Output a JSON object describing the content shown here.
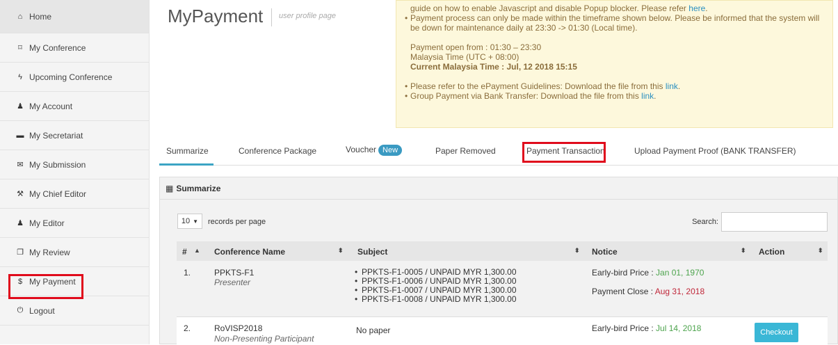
{
  "sidebar": {
    "items": [
      {
        "label": "Home",
        "icon": "home-icon",
        "glyph": "⌂"
      },
      {
        "label": "My Conference",
        "icon": "bookmark-icon",
        "glyph": "⌑"
      },
      {
        "label": "Upcoming Conference",
        "icon": "bolt-icon",
        "glyph": "ϟ"
      },
      {
        "label": "My Account",
        "icon": "user-icon",
        "glyph": "♟"
      },
      {
        "label": "My Secretariat",
        "icon": "briefcase-icon",
        "glyph": "▬"
      },
      {
        "label": "My Submission",
        "icon": "envelope-icon",
        "glyph": "✉"
      },
      {
        "label": "My Chief Editor",
        "icon": "gavel-icon",
        "glyph": "⚒"
      },
      {
        "label": "My Editor",
        "icon": "users-icon",
        "glyph": "♟"
      },
      {
        "label": "My Review",
        "icon": "files-icon",
        "glyph": "❐"
      },
      {
        "label": "My Payment",
        "icon": "dollar-icon",
        "glyph": "$"
      },
      {
        "label": "Logout",
        "icon": "power-icon",
        "glyph": "⏻"
      }
    ]
  },
  "header": {
    "title": "MyPayment",
    "subtitle": "user profile page"
  },
  "notice": {
    "line1_text": "guide on how to enable Javascript and disable Popup blocker. Please refer ",
    "line1_link": "here",
    "line1_end": ".",
    "payment_process": "Payment process can only be made within the timeframe shown below. Please be informed that the system will be down for maintenance daily at 23:30 -> 01:30 (Local time).",
    "open_from": "Payment open from : 01:30 – 23:30",
    "timezone": "Malaysia Time (UTC + 08:00)",
    "current_time": "Current Malaysia Time : Jul, 12 2018 15:15",
    "guidelines_text": "Please refer to the ePayment Guidelines: Download the file from this ",
    "guidelines_link": "link",
    "guidelines_end": ".",
    "group_text": "Group Payment via Bank Transfer: Download the file from this ",
    "group_link": "link",
    "group_end": "."
  },
  "tabs": [
    {
      "label": "Summarize"
    },
    {
      "label": "Conference Package"
    },
    {
      "label": "Voucher",
      "badge": "New"
    },
    {
      "label": "Paper Removed"
    },
    {
      "label": "Payment Transaction"
    },
    {
      "label": "Upload Payment Proof (BANK TRANSFER)"
    }
  ],
  "panel": {
    "title": "Summarize",
    "icon": "table-icon",
    "length_value": "10",
    "length_label": "records per page",
    "search_label": "Search:"
  },
  "table": {
    "headers": [
      "#",
      "Conference Name",
      "Subject",
      "Notice",
      "Action"
    ],
    "rows": [
      {
        "num": "1.",
        "name": "PPKTS-F1",
        "role": "Presenter",
        "subjects": [
          "PPKTS-F1-0005 / UNPAID MYR 1,300.00",
          "PPKTS-F1-0006 / UNPAID MYR 1,300.00",
          "PPKTS-F1-0007 / UNPAID MYR 1,300.00",
          "PPKTS-F1-0008 / UNPAID MYR 1,300.00"
        ],
        "early_label": "Early-bird Price : ",
        "early_date": "Jan 01, 1970",
        "close_label": "Payment Close : ",
        "close_date": "Aug 31, 2018"
      },
      {
        "num": "2.",
        "name": "RoVISP2018",
        "role": "Non-Presenting Participant",
        "subject": "No paper",
        "early_label": "Early-bird Price : ",
        "early_date": "Jul 14, 2018",
        "action": "Checkout"
      }
    ]
  }
}
